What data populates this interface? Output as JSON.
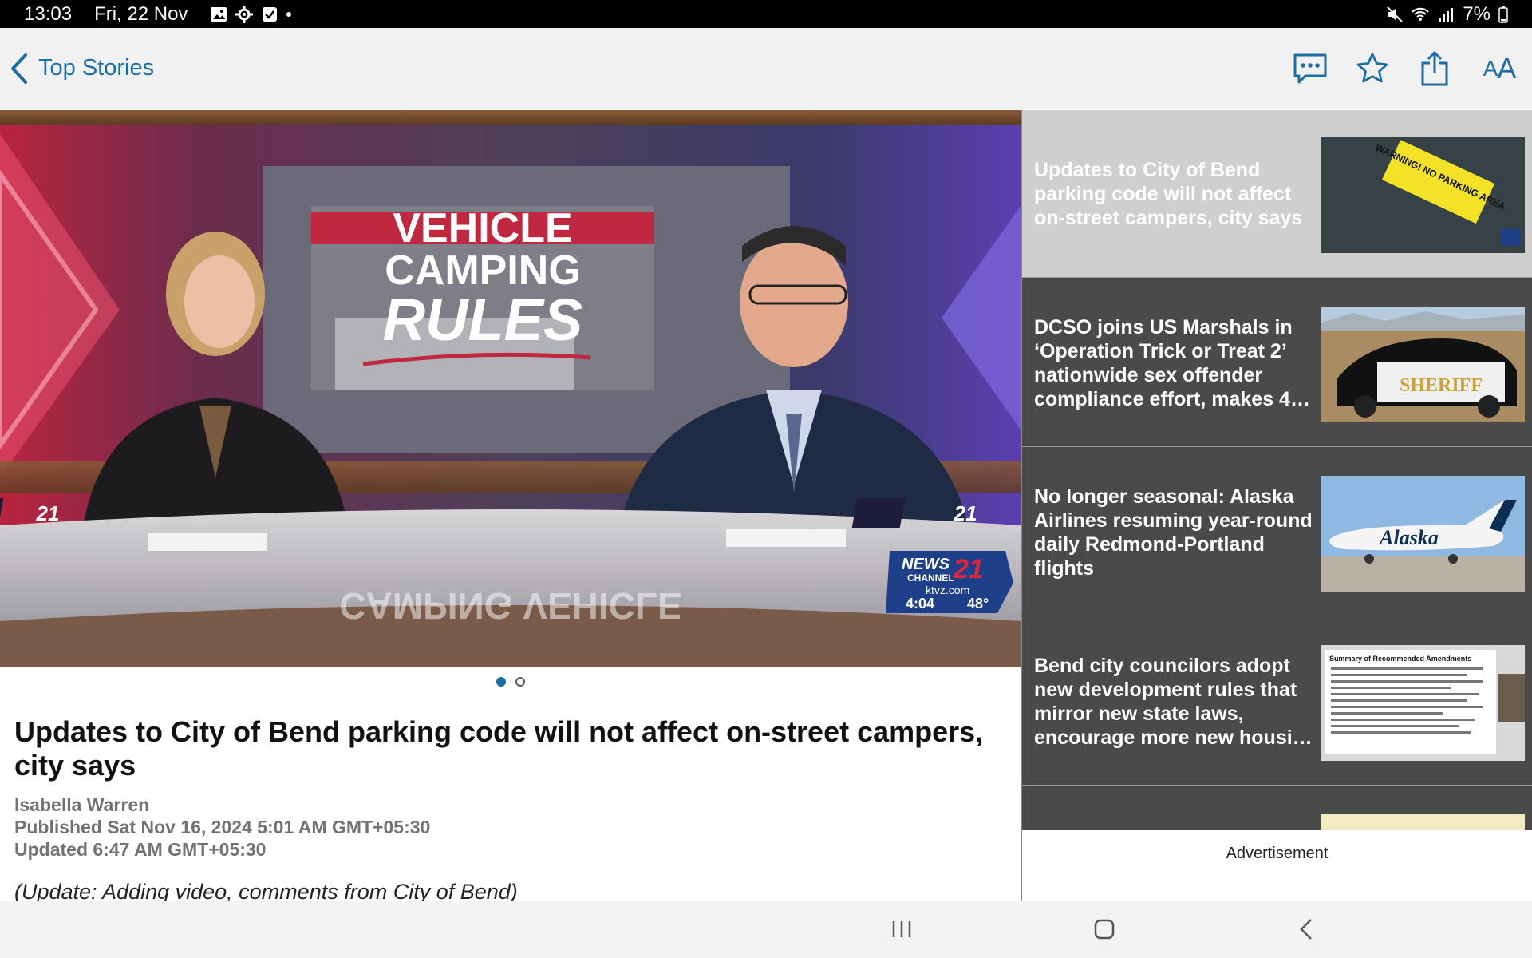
{
  "status_bar": {
    "time": "13:03",
    "date": "Fri, 22 Nov",
    "battery": "7%"
  },
  "app_bar": {
    "back_label": "Top Stories",
    "text_size_label_big": "A",
    "text_size_label_small": "A",
    "accent_color": "#1c6ea4"
  },
  "media": {
    "graphic_line1": "VEHICLE",
    "graphic_line2": "CAMPING",
    "graphic_line3": "RULES",
    "reflection_text": "CAMPING VEHICLE",
    "desk_logo": "21",
    "bug_line1": "NEWS",
    "bug_line2": "CHANNEL",
    "bug_number": "21",
    "bug_site": "ktvz.com",
    "bug_time": "4:04",
    "bug_temp": "48°"
  },
  "pager": {
    "count": 2,
    "active": 0
  },
  "article": {
    "headline": "Updates to City of Bend parking code will not affect on-street campers, city says",
    "author": "Isabella Warren",
    "published": "Published Sat Nov 16, 2024 5:01 AM GMT+05:30",
    "updated": "Updated 6:47 AM GMT+05:30",
    "update_note": "(Update: Adding video, comments from City of Bend)"
  },
  "sidebar": {
    "stories": [
      {
        "title": "Updates to City of Bend parking code will not affect on-street campers, city says",
        "thumb": "parking-warning",
        "thumb_text": "WARNING! NO PARKING AREA"
      },
      {
        "title": "DCSO joins US Marshals in ‘Operation Trick or Treat 2’ nationwide sex offender compliance effort, makes 4…",
        "thumb": "sheriff-car",
        "thumb_text": "SHERIFF"
      },
      {
        "title": "No longer seasonal: Alaska Airlines resuming year-round daily Redmond-Portland flights",
        "thumb": "alaska-plane",
        "thumb_text": "Alaska"
      },
      {
        "title": "Bend city councilors adopt new development rules that mirror new state laws, encourage more new housi…",
        "thumb": "amendments-doc",
        "thumb_text": "Summary of Recommended Amendments"
      }
    ],
    "advertisement_label": "Advertisement"
  }
}
